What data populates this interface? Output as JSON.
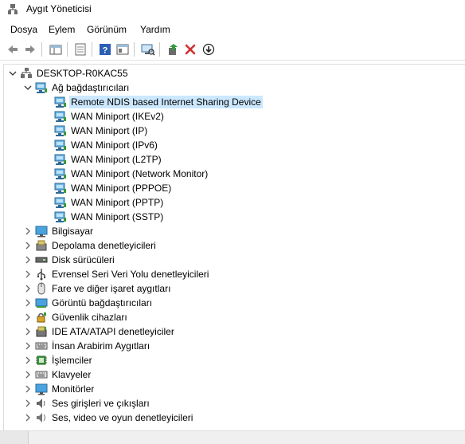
{
  "window": {
    "title": "Aygıt Yöneticisi"
  },
  "menu": {
    "items": [
      {
        "label": "Dosya"
      },
      {
        "label": "Eylem"
      },
      {
        "label": "Görünüm"
      },
      {
        "label": "Yardım"
      }
    ]
  },
  "toolbar": {
    "buttons": [
      {
        "icon": "back-arrow-icon"
      },
      {
        "icon": "forward-arrow-icon"
      },
      {
        "icon": "show-hide-console-tree-icon"
      },
      {
        "icon": "properties-icon"
      },
      {
        "icon": "help-icon"
      },
      {
        "icon": "view-icon"
      },
      {
        "icon": "scan-hardware-changes-icon"
      },
      {
        "icon": "update-driver-icon"
      },
      {
        "icon": "uninstall-device-icon"
      },
      {
        "icon": "download-driver-icon"
      }
    ]
  },
  "tree": {
    "root": {
      "label": "DESKTOP-R0KAC55"
    },
    "network_group": {
      "label": "Ağ bağdaştırıcıları",
      "children": [
        {
          "label": "Remote NDIS based Internet Sharing Device",
          "selected": true
        },
        {
          "label": "WAN Miniport (IKEv2)"
        },
        {
          "label": "WAN Miniport (IP)"
        },
        {
          "label": "WAN Miniport (IPv6)"
        },
        {
          "label": "WAN Miniport (L2TP)"
        },
        {
          "label": "WAN Miniport (Network Monitor)"
        },
        {
          "label": "WAN Miniport (PPPOE)"
        },
        {
          "label": "WAN Miniport (PPTP)"
        },
        {
          "label": "WAN Miniport (SSTP)"
        }
      ]
    },
    "categories": [
      {
        "label": "Bilgisayar",
        "icon": "computer-icon"
      },
      {
        "label": "Depolama denetleyicileri",
        "icon": "storage-controller-icon"
      },
      {
        "label": "Disk sürücüleri",
        "icon": "disk-drive-icon"
      },
      {
        "label": "Evrensel Seri Veri Yolu denetleyicileri",
        "icon": "usb-icon"
      },
      {
        "label": "Fare ve diğer işaret aygıtları",
        "icon": "mouse-icon"
      },
      {
        "label": "Görüntü bağdaştırıcıları",
        "icon": "display-adapter-icon"
      },
      {
        "label": "Güvenlik cihazları",
        "icon": "security-device-icon"
      },
      {
        "label": "IDE ATA/ATAPI denetleyiciler",
        "icon": "ide-controller-icon"
      },
      {
        "label": "İnsan Arabirim Aygıtları",
        "icon": "hid-icon"
      },
      {
        "label": "İşlemciler",
        "icon": "processor-icon"
      },
      {
        "label": "Klavyeler",
        "icon": "keyboard-icon"
      },
      {
        "label": "Monitörler",
        "icon": "monitor-icon"
      },
      {
        "label": "Ses girişleri ve çıkışları",
        "icon": "speaker-icon"
      },
      {
        "label": "Ses, video ve oyun denetleyicileri",
        "icon": "sound-video-icon"
      }
    ]
  },
  "colors": {
    "selection": "#cce8ff",
    "accent_blue": "#1e88e5",
    "red_x": "#d32f2f",
    "green_arrow": "#2e7d32"
  }
}
